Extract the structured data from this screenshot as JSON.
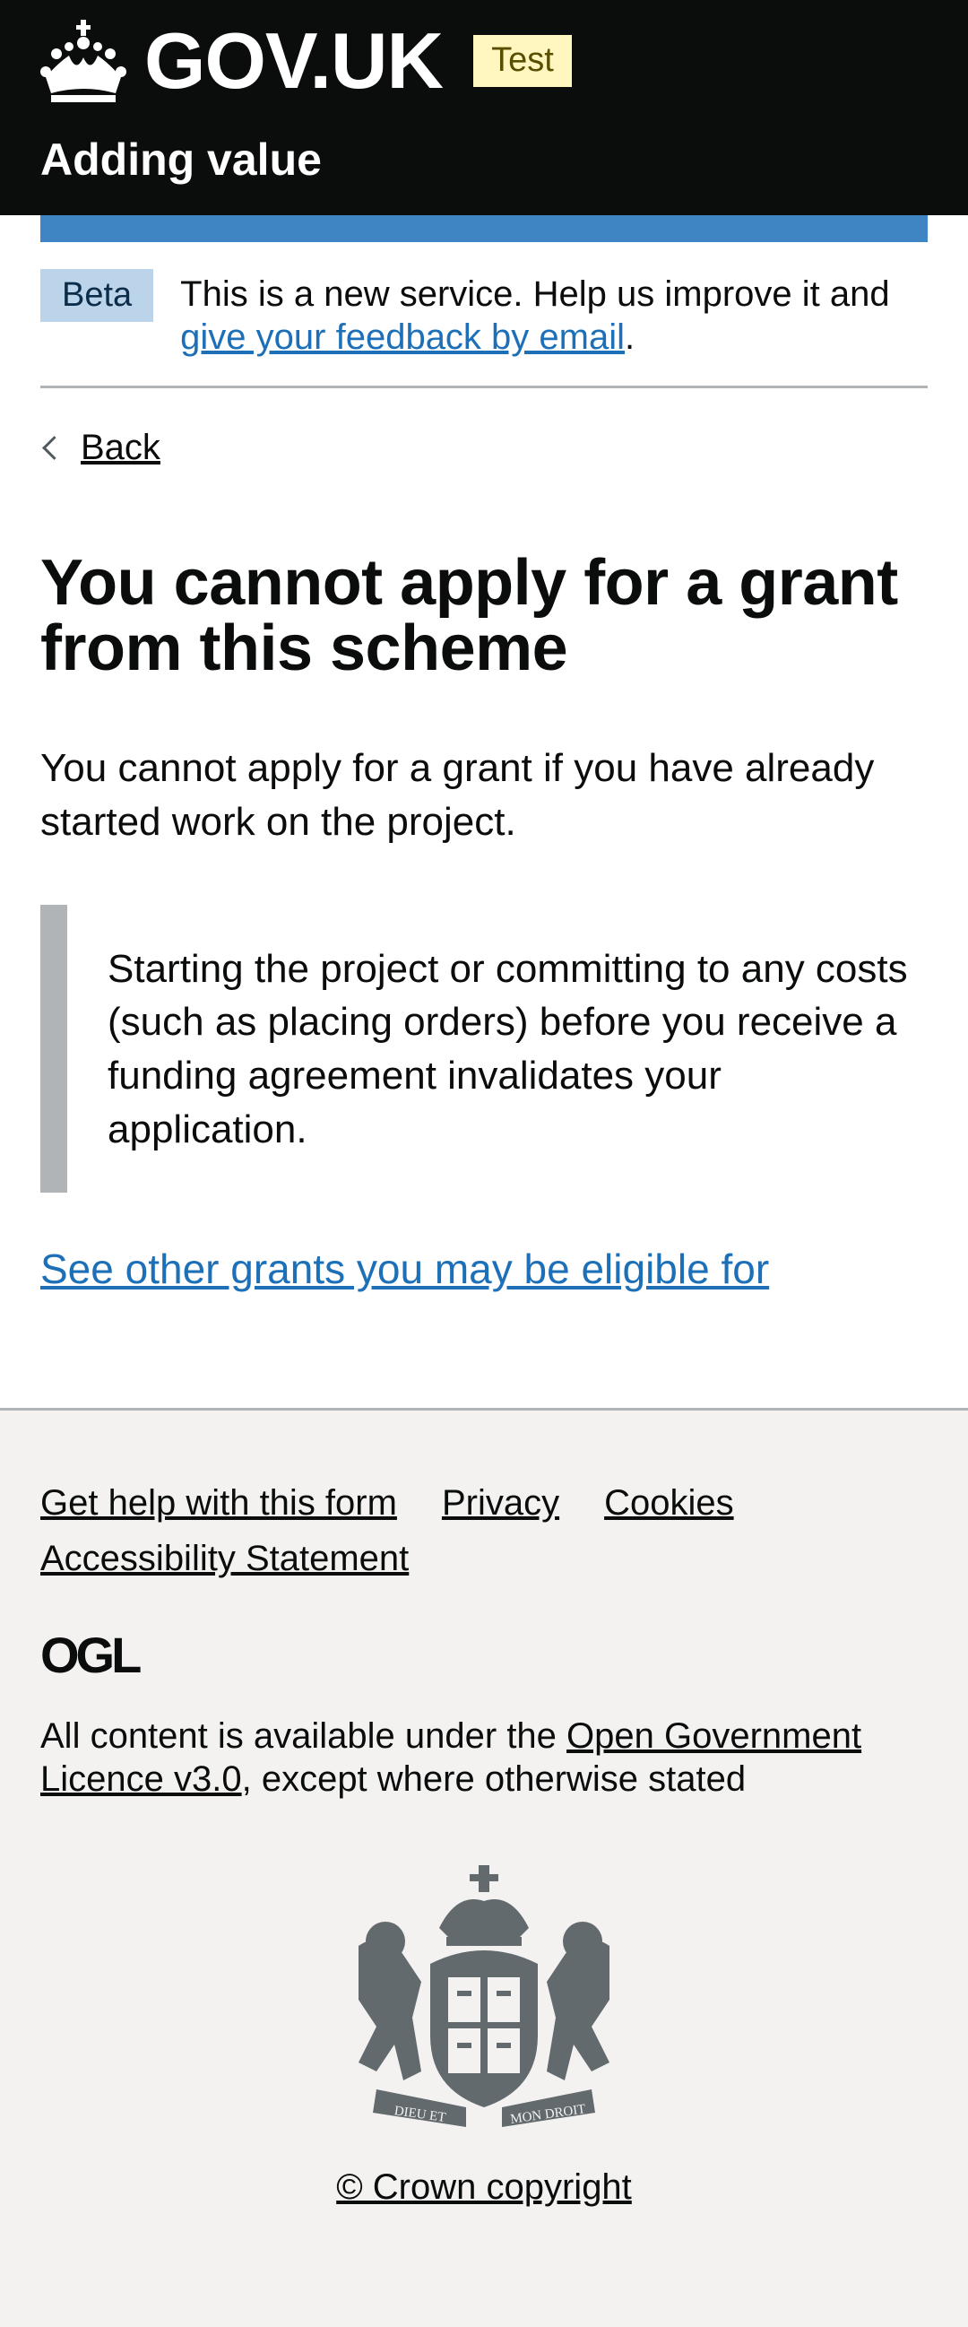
{
  "header": {
    "logo_text": "GOV.UK",
    "env_tag": "Test",
    "service_name": "Adding value"
  },
  "phase_banner": {
    "tag": "Beta",
    "text": "This is a new service. Help us improve it and ",
    "link": "give your feedback by email",
    "suffix": "."
  },
  "navigation": {
    "back_label": "Back"
  },
  "main": {
    "title": "You cannot apply for a grant from this scheme",
    "body": "You cannot apply for a grant if you have already started work on the project.",
    "inset": "Starting the project or committing to any costs (such as placing orders) before you receive a funding agreement invalidates your application.",
    "other_grants_link": "See other grants you may be eligible for"
  },
  "footer": {
    "links": [
      "Get help with this form",
      "Privacy",
      "Cookies",
      "Accessibility Statement"
    ],
    "ogl_logo": "OGL",
    "licence_prefix": "All content is available under the ",
    "licence_link": "Open Government Licence v3.0",
    "licence_suffix": ", except where otherwise stated",
    "crest_motto_left": "DIEU ET",
    "crest_motto_right": "MON DROIT",
    "copyright": "© Crown copyright"
  },
  "colors": {
    "header_bg": "#0b0c0c",
    "link": "#1d70b8",
    "beta_tag_bg": "#bbd4ea",
    "test_tag_bg": "#fff7bf",
    "inset_border": "#b1b4b6",
    "footer_bg": "#f3f2f1"
  }
}
